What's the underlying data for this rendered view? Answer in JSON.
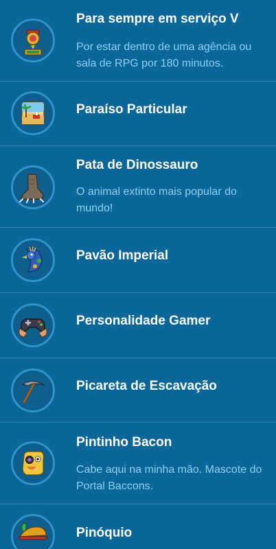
{
  "badges": [
    {
      "name": "Para sempre em serviço V",
      "description": "Por estar dentro de uma agência ou sala de RPG por 180 minutos.",
      "icon": "service-medal-icon"
    },
    {
      "name": "Paraíso Particular",
      "description": "",
      "icon": "beach-island-icon"
    },
    {
      "name": "Pata de Dinossauro",
      "description": "O animal extinto mais popular do mundo!",
      "icon": "dinosaur-foot-icon"
    },
    {
      "name": "Pavão Imperial",
      "description": "",
      "icon": "peacock-icon"
    },
    {
      "name": "Personalidade Gamer",
      "description": "",
      "icon": "game-controller-icon"
    },
    {
      "name": "Picareta de Escavação",
      "description": "",
      "icon": "pickaxe-icon"
    },
    {
      "name": "Pintinho Bacon",
      "description": "Cabe aqui na minha mão. Mascote do Portal Baccons.",
      "icon": "bacon-chick-icon"
    },
    {
      "name": "Pinóquio",
      "description": "",
      "icon": "pinocchio-hat-icon"
    }
  ],
  "colors": {
    "background": "#0b6699",
    "divider": "#2a82b6",
    "name_text": "#ffffff",
    "description_text": "#8fd0f0",
    "icon_ring": "#2f93cc"
  }
}
